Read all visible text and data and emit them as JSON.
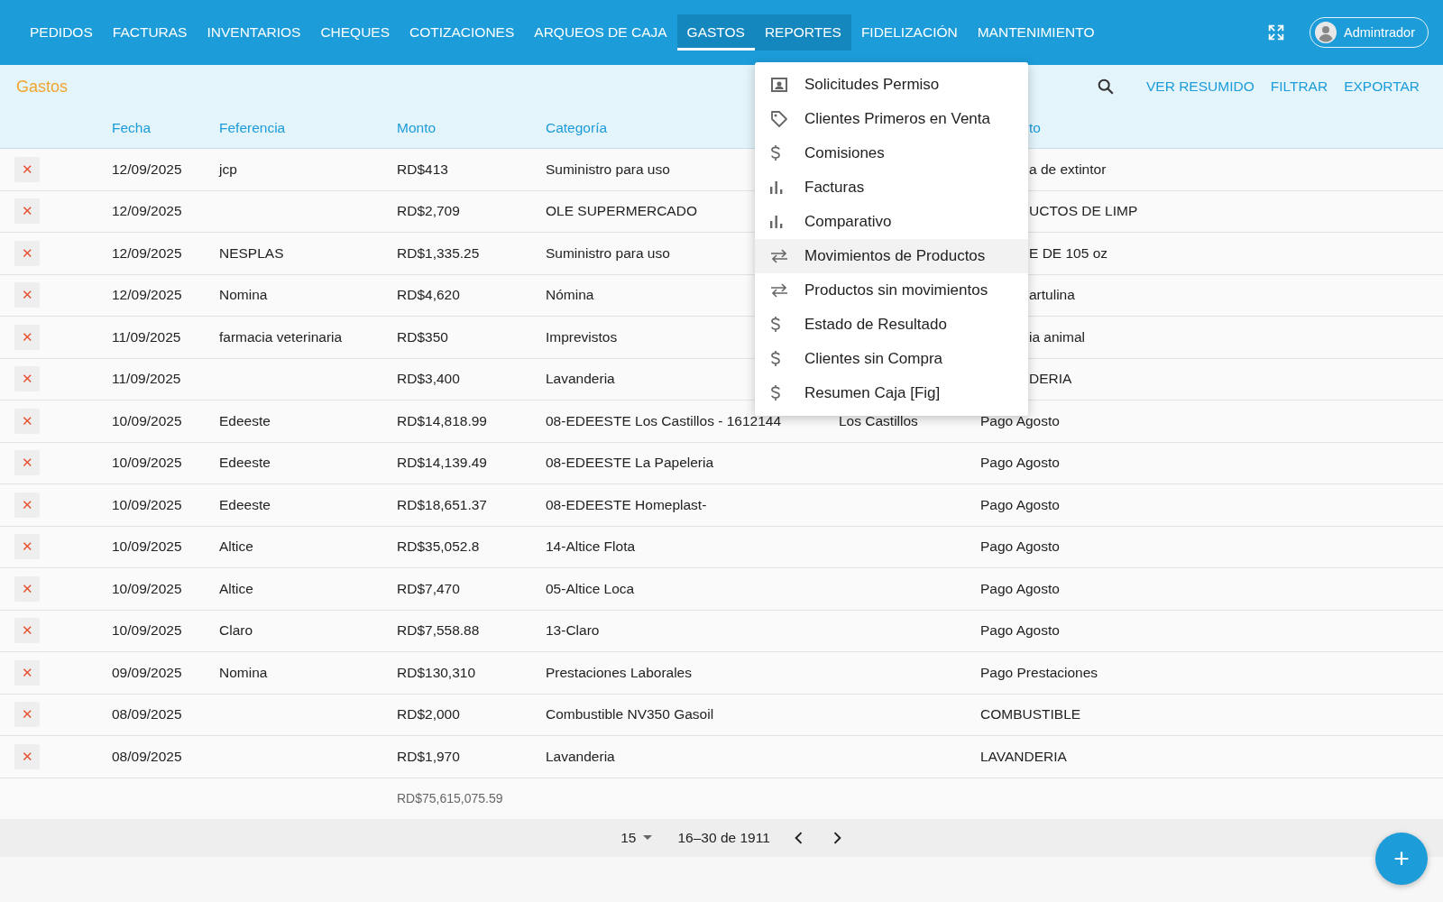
{
  "nav": {
    "items": [
      {
        "label": "PEDIDOS",
        "selected": false,
        "open": false
      },
      {
        "label": "FACTURAS",
        "selected": false,
        "open": false
      },
      {
        "label": "INVENTARIOS",
        "selected": false,
        "open": false
      },
      {
        "label": "CHEQUES",
        "selected": false,
        "open": false
      },
      {
        "label": "COTIZACIONES",
        "selected": false,
        "open": false
      },
      {
        "label": "ARQUEOS DE CAJA",
        "selected": false,
        "open": false
      },
      {
        "label": "GASTOS",
        "selected": true,
        "open": false
      },
      {
        "label": "REPORTES",
        "selected": false,
        "open": true
      },
      {
        "label": "FIDELIZACIÓN",
        "selected": false,
        "open": false
      },
      {
        "label": "MANTENIMIENTO",
        "selected": false,
        "open": false
      }
    ],
    "user": "Admintrador"
  },
  "toolbar": {
    "title": "Gastos",
    "actions": [
      "VER RESUMIDO",
      "FILTRAR",
      "EXPORTAR"
    ]
  },
  "reports_menu": {
    "items": [
      {
        "kind": "person",
        "label": "Solicitudes Permiso",
        "highlighted": false
      },
      {
        "kind": "tag",
        "label": "Clientes Primeros en Venta",
        "highlighted": false
      },
      {
        "kind": "money",
        "label": "Comisiones",
        "highlighted": false
      },
      {
        "kind": "chart",
        "label": "Facturas",
        "highlighted": false
      },
      {
        "kind": "chart",
        "label": "Comparativo",
        "highlighted": false
      },
      {
        "kind": "swap",
        "label": "Movimientos de Productos",
        "highlighted": true
      },
      {
        "kind": "swap",
        "label": "Productos sin movimientos",
        "highlighted": false
      },
      {
        "kind": "money",
        "label": "Estado de Resultado",
        "highlighted": false
      },
      {
        "kind": "money",
        "label": "Clientes sin Compra",
        "highlighted": false
      },
      {
        "kind": "money",
        "label": "Resumen Caja [Fig]",
        "highlighted": false
      }
    ]
  },
  "table": {
    "columns": [
      "Fecha",
      "Feferencia",
      "Monto",
      "Categoría",
      "",
      "to"
    ],
    "rows": [
      {
        "delete": "✕",
        "fecha": "12/09/2025",
        "referencia": "jcp",
        "monto": "RD$413",
        "categoria": "Suministro para uso",
        "concepto": "a de extintor"
      },
      {
        "delete": "✕",
        "fecha": "12/09/2025",
        "monto": "RD$2,709",
        "categoria": "OLE SUPERMERCADO",
        "concepto": "UCTOS DE LIMP"
      },
      {
        "delete": "✕",
        "fecha": "12/09/2025",
        "referencia": "NESPLAS",
        "monto": "RD$1,335.25",
        "categoria": "Suministro para uso",
        "concepto": "E DE 105 oz"
      },
      {
        "delete": "✕",
        "fecha": "12/09/2025",
        "referencia": "Nomina",
        "monto": "RD$4,620",
        "categoria": "Nómina",
        "concepto": "artulina"
      },
      {
        "delete": "✕",
        "fecha": "11/09/2025",
        "referencia": "farmacia veterinaria",
        "monto": "RD$350",
        "categoria": "Imprevistos",
        "concepto": "ia animal"
      },
      {
        "delete": "✕",
        "fecha": "11/09/2025",
        "monto": "RD$3,400",
        "categoria": "Lavanderia",
        "concepto": "DERIA"
      },
      {
        "delete": "✕",
        "fecha": "10/09/2025",
        "referencia": "Edeeste",
        "monto": "RD$14,818.99",
        "categoria": "08-EDEESTE Los Castillos - 1612144",
        "lugar": "Los Castillos",
        "concepto": "Pago Agosto"
      },
      {
        "delete": "✕",
        "fecha": "10/09/2025",
        "referencia": "Edeeste",
        "monto": "RD$14,139.49",
        "categoria": "08-EDEESTE La Papeleria",
        "concepto": "Pago Agosto"
      },
      {
        "delete": "✕",
        "fecha": "10/09/2025",
        "referencia": "Edeeste",
        "monto": "RD$18,651.37",
        "categoria": "08-EDEESTE Homeplast-",
        "concepto": "Pago Agosto"
      },
      {
        "delete": "✕",
        "fecha": "10/09/2025",
        "referencia": "Altice",
        "monto": "RD$35,052.8",
        "categoria": "14-Altice Flota",
        "concepto": "Pago Agosto"
      },
      {
        "delete": "✕",
        "fecha": "10/09/2025",
        "referencia": "Altice",
        "monto": "RD$7,470",
        "categoria": "05-Altice Loca",
        "concepto": "Pago Agosto"
      },
      {
        "delete": "✕",
        "fecha": "10/09/2025",
        "referencia": "Claro",
        "monto": "RD$7,558.88",
        "categoria": "13-Claro",
        "concepto": "Pago Agosto"
      },
      {
        "delete": "✕",
        "fecha": "09/09/2025",
        "referencia": "Nomina",
        "monto": "RD$130,310",
        "categoria": "Prestaciones Laborales",
        "concepto": "Pago Prestaciones"
      },
      {
        "delete": "✕",
        "fecha": "08/09/2025",
        "monto": "RD$2,000",
        "categoria": "Combustible NV350 Gasoil",
        "concepto": "COMBUSTIBLE"
      },
      {
        "delete": "✕",
        "fecha": "08/09/2025",
        "monto": "RD$1,970",
        "categoria": "Lavanderia",
        "concepto": "LAVANDERIA"
      }
    ],
    "total": "RD$75,615,075.59"
  },
  "pagination": {
    "page_size": "15",
    "range": "16–30 de 1911"
  },
  "fab": "+"
}
